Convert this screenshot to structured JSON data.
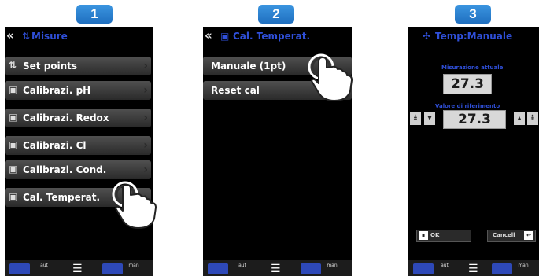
{
  "steps": [
    "1",
    "2",
    "3"
  ],
  "screen1": {
    "header_title": "Misure",
    "items": [
      {
        "icon": "⇅",
        "label": "Set points"
      },
      {
        "icon": "▣",
        "label": "Calibrazi. pH"
      },
      {
        "icon": "▣",
        "label": "Calibrazi. Redox"
      },
      {
        "icon": "▣",
        "label": "Calibrazi. Cl"
      },
      {
        "icon": "▣",
        "label": "Calibrazi. Cond."
      },
      {
        "icon": "▣",
        "label": "Cal. Temperat."
      }
    ]
  },
  "screen2": {
    "header_title": "Cal. Temperat.",
    "items": [
      {
        "label": "Manuale (1pt)"
      },
      {
        "label": "Reset cal"
      }
    ]
  },
  "screen3": {
    "header_title": "Temp:Manuale",
    "actual_label": "Misurazione attuale",
    "actual_value": "27.3",
    "target_label": "Valore di riferimento",
    "target_value": "27.3",
    "ok_label": "OK",
    "cancel_label": "Cancell"
  },
  "bottom_bar": {
    "aut_label": "aut",
    "man_label": "man"
  },
  "colors": {
    "accent_blue": "#2f4fd8",
    "badge_blue": "#2a80d4"
  }
}
